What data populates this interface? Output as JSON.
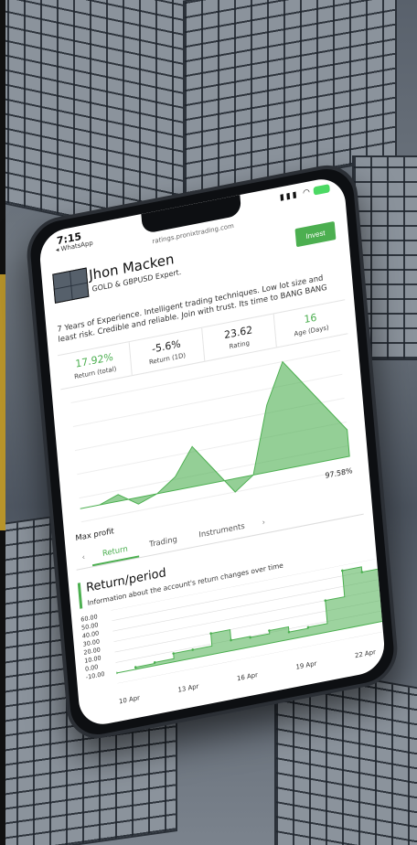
{
  "status": {
    "time": "7:15",
    "back_app": "WhatsApp"
  },
  "browser": {
    "url": "ratings.pronixtrading.com"
  },
  "profile": {
    "name": "Jhon Macken",
    "tagline": "GOLD & GBPUSD Expert.",
    "invest_label": "Invest"
  },
  "about": "7 Years of Experience. Intelligent trading techniques. Low lot size and least risk. Credible and reliable. Join with trust. Its time to BANG BANG",
  "stats": [
    {
      "value": "17.92%",
      "label": "Return (total)",
      "color": "#4caf50"
    },
    {
      "value": "-5.6%",
      "label": "Return (1D)",
      "color": "#222222"
    },
    {
      "value": "23.62",
      "label": "Rating",
      "color": "#222222"
    },
    {
      "value": "16",
      "label": "Age (Days)",
      "color": "#4caf50"
    }
  ],
  "max_profit": {
    "label": "Max profit",
    "value": "97.58%"
  },
  "tabs": {
    "items": [
      "Return",
      "Trading",
      "Instruments"
    ],
    "active": "Return"
  },
  "panel": {
    "title": "Return/period",
    "subtitle": "Information about the account's return changes over time"
  },
  "chart_data": {
    "type": "area",
    "y_ticks": [
      "60.00",
      "50.00",
      "40.00",
      "30.00",
      "20.00",
      "10.00",
      "0.00",
      "-10.00"
    ],
    "x_ticks": [
      "10 Apr",
      "13 Apr",
      "16 Apr",
      "19 Apr",
      "22 Apr"
    ],
    "ylim": [
      -10,
      60
    ],
    "x": [
      "9 Apr",
      "10 Apr",
      "11 Apr",
      "12 Apr",
      "13 Apr",
      "14 Apr",
      "15 Apr",
      "16 Apr",
      "17 Apr",
      "18 Apr",
      "19 Apr",
      "20 Apr",
      "21 Apr",
      "22 Apr",
      "23 Apr"
    ],
    "values": [
      0,
      2,
      3,
      8,
      8,
      20,
      10,
      9,
      12,
      7,
      8,
      30,
      55,
      50,
      38
    ],
    "color": "#4caf50"
  },
  "mini_chart": {
    "values": [
      0,
      0,
      0.5,
      -0.5,
      0,
      1,
      3,
      1,
      -1,
      0,
      5,
      8,
      6,
      4,
      2
    ]
  }
}
